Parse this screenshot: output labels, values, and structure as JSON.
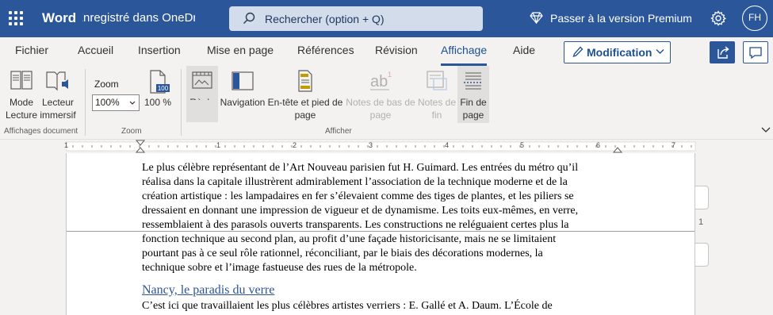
{
  "titlebar": {
    "app_name": "Word",
    "doc_status": "Enregistré dans OneDrive",
    "search_placeholder": "Rechercher (option + Q)",
    "premium_label": "Passer à la version Premium",
    "avatar_initials": "FH",
    "color": "#2b579a"
  },
  "tabs": {
    "items": [
      "Fichier",
      "Accueil",
      "Insertion",
      "Mise en page",
      "Références",
      "Révision",
      "Affichage",
      "Aide"
    ],
    "active": "Affichage",
    "edit_mode_label": "Modification"
  },
  "ribbon": {
    "doc_views": {
      "mode_lecture": [
        "Mode",
        "Lecture"
      ],
      "lecteur_immersif": [
        "Lecteur",
        "immersif"
      ],
      "group_label": "Affichages document"
    },
    "zoom": {
      "label": "Zoom",
      "value": "100%",
      "hundred_label": "100 %",
      "icon_text": "100",
      "group_label": "Zoom"
    },
    "show": {
      "regle": "Règle",
      "navigation": "Navigation",
      "entete": [
        "En-tête et pied de",
        "page"
      ],
      "notes_bas": [
        "Notes de bas de",
        "page"
      ],
      "notes_fin": [
        "Notes de",
        "fin"
      ],
      "fin_page": [
        "Fin de",
        "page"
      ],
      "group_label": "Afficher"
    }
  },
  "ruler": {
    "numbers": [
      "1",
      "1",
      "2",
      "3",
      "4",
      "5",
      "6",
      "7"
    ]
  },
  "document": {
    "page1_lines": [
      "Le plus célèbre représentant de l’Art Nouveau parisien fut H. Guimard. Les entrées du métro qu’il",
      "réalisa dans la capitale illustrèrent admirablement l’association de la technique moderne et de la",
      "création artistique : les lampadaires en fer s’élevaient comme des tiges de plantes, et les piliers se",
      "dressaient en donnant une impression de vigueur et de dynamisme. Les toits eux-mêmes, en verre,",
      "ressemblaient à des parasols ouverts transparents. Les constructions ne reléguaient certes plus la"
    ],
    "page2_lines": [
      "fonction technique au second plan, au profit d’une façade historicisante, mais ne se limitaient",
      "pourtant pas à ce seul rôle rationnel, réconciliant, par le biais des décorations modernes, la",
      "technique sobre et l’image fastueuse des rues de la métropole."
    ],
    "heading": "Nancy, le paradis du verre",
    "last_line": "C’est ici que travaillaient les plus célèbres artistes verriers : E. Gallé et A. Daum. L’École de",
    "page_number": "1"
  }
}
